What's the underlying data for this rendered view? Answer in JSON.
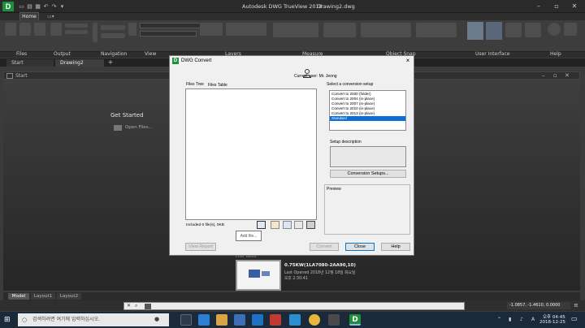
{
  "app": {
    "title": "Autodesk DWG TrueView 2018",
    "document": "Drawing2.dwg",
    "logo_letter": "D"
  },
  "ribbon": {
    "home_tab": "Home",
    "panels": [
      "Files",
      "Output",
      "Navigation",
      "View",
      "Layers",
      "Measure",
      "Object Snap",
      "User Interface",
      "Help"
    ]
  },
  "doc_tabs": [
    "Start",
    "Drawing2"
  ],
  "start_window": {
    "title": "Start",
    "get_started": "Get Started",
    "open_files": "Open Files..."
  },
  "dialog": {
    "title": "DWG Convert",
    "close_glyph": "×",
    "current_user": "Current user: Mr. Jeong",
    "tabs": [
      "Files Tree",
      "Files Table"
    ],
    "files_info": "Included 0 file(s), 0KB",
    "add_file": "Add file...",
    "select_setup_label": "Select a conversion setup",
    "setups": [
      "Convert to 2000 (folder)",
      "Convert to 2004 (in-place)",
      "Convert to 2007 (in-place)",
      "Convert to 2010 (in-place)",
      "Convert to 2013 (in-place)",
      "Standard"
    ],
    "selected_setup": "Standard",
    "setup_description_label": "Setup description",
    "conversion_setups_button": "Conversion Setups...",
    "preview_label": "Preview",
    "view_report_button": "View Report",
    "convert_button": "Convert",
    "close_button": "Close",
    "help_button": "Help"
  },
  "recent": {
    "header": "LAST WEEK",
    "file_name": "0.75KW(1LA7080-2AA90,10)",
    "last_opened": "Last Opened 2018년 12월 18일 화요일",
    "time": "오후 2:30:41"
  },
  "layout_tabs": [
    "Model",
    "Layout1",
    "Layout2"
  ],
  "status": {
    "coords": "-1.0857, -1.4610, 0.0000"
  },
  "taskbar": {
    "search_placeholder": "검색하려면 여기에 입력하십시오.",
    "time": "오후 04:45",
    "date": "2018-12-25"
  }
}
